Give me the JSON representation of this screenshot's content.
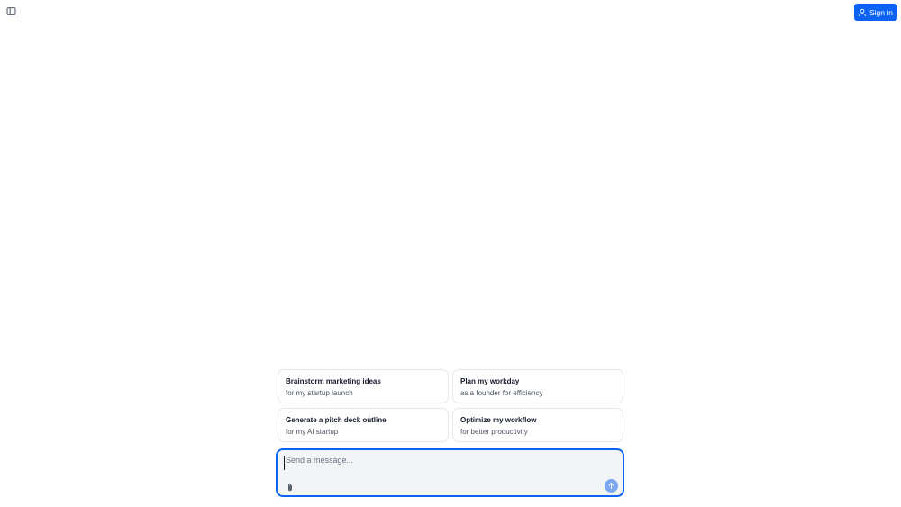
{
  "header": {
    "sidebar_toggle_icon": "sidebar-toggle-icon",
    "signin_label": "Sign in",
    "signin_icon": "user-icon",
    "accent_color": "#0b63f6"
  },
  "suggestions": [
    {
      "title": "Brainstorm marketing ideas",
      "subtitle": "for my startup launch"
    },
    {
      "title": "Plan my workday",
      "subtitle": "as a founder for efficiency"
    },
    {
      "title": "Generate a pitch deck outline",
      "subtitle": "for my AI startup"
    },
    {
      "title": "Optimize my workflow",
      "subtitle": "for better productivity"
    }
  ],
  "composer": {
    "placeholder": "Send a message...",
    "value": "",
    "attach_icon": "paperclip-icon",
    "send_icon": "arrow-up-icon"
  }
}
